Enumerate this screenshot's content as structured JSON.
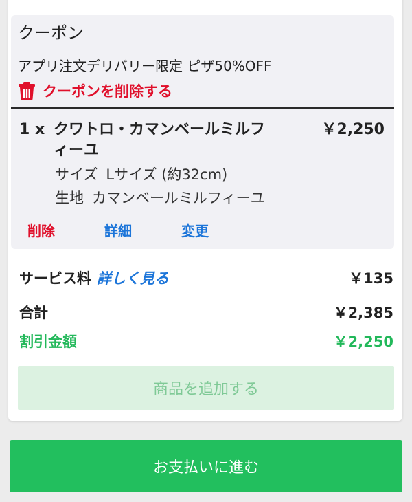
{
  "coupon": {
    "title": "クーポン",
    "description": "アプリ注文デリバリー限定 ピザ50%OFF",
    "remove_label": "クーポンを削除する"
  },
  "item": {
    "quantity": "1 x",
    "name": "クワトロ・カマンベールミルフィーユ",
    "price": "￥2,250",
    "options": [
      {
        "key": "サイズ",
        "value": "Lサイズ (約32cm)"
      },
      {
        "key": "生地",
        "value": "カマンベールミルフィーユ"
      }
    ],
    "actions": {
      "delete": "削除",
      "details": "詳細",
      "change": "変更"
    }
  },
  "summary": {
    "service_label": "サービス料",
    "service_more": "詳しく見る",
    "service_value": "￥135",
    "total_label": "合計",
    "total_value": "￥2,385",
    "discount_label": "割引金額",
    "discount_value": "￥2,250"
  },
  "buttons": {
    "add_items": "商品を追加する",
    "pay": "お支払いに進む"
  },
  "colors": {
    "danger": "#e0102b",
    "link": "#1c75d9",
    "brand_green": "#22bf5e",
    "discount_green": "#22b85a"
  },
  "icons": {
    "coupon_remove": "trash-icon"
  }
}
